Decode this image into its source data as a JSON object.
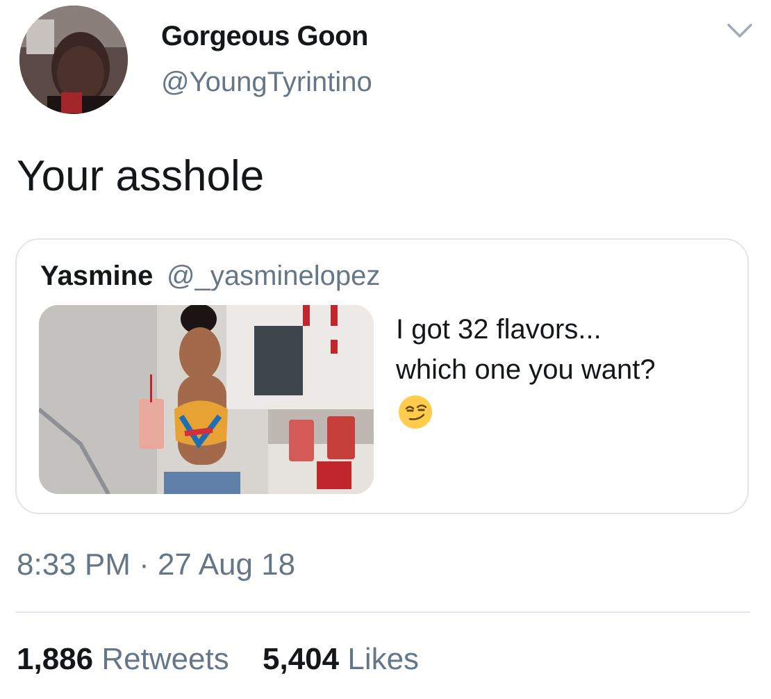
{
  "tweet": {
    "author": {
      "display_name": "Gorgeous Goon",
      "handle": "@YoungTyrintino",
      "avatar_icon": "profile-photo"
    },
    "text": "Your asshole",
    "menu_icon": "chevron-down-icon",
    "quoted_tweet": {
      "display_name": "Yasmine",
      "handle": "@_yasminelopez",
      "text_lines": [
        "I got 32 flavors...",
        "which one you want?"
      ],
      "emoji": "smirking-face-emoji"
    },
    "timestamp": "8:33 PM · 27 Aug 18",
    "stats": {
      "retweets_count": "1,886",
      "retweets_label": "Retweets",
      "likes_count": "5,404",
      "likes_label": "Likes"
    }
  },
  "colors": {
    "primary_text": "#14171a",
    "secondary_text": "#657786",
    "border": "#dfe5ea",
    "emoji_yellow": "#ffcc4d"
  }
}
